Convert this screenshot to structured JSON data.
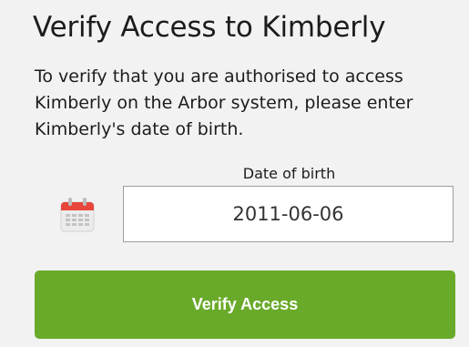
{
  "heading": {
    "title": "Verify Access to Kimberly"
  },
  "intro": {
    "text": "To verify that you are authorised to access Kimberly on the Arbor system, please enter Kimberly's date of birth."
  },
  "dob": {
    "label": "Date of birth",
    "value": "2011-06-06",
    "icon": "calendar-icon"
  },
  "actions": {
    "verify_label": "Verify Access"
  },
  "colors": {
    "accent": "#6aaa2a",
    "calendar_red": "#e8453c",
    "background": "#f2f2f2"
  }
}
